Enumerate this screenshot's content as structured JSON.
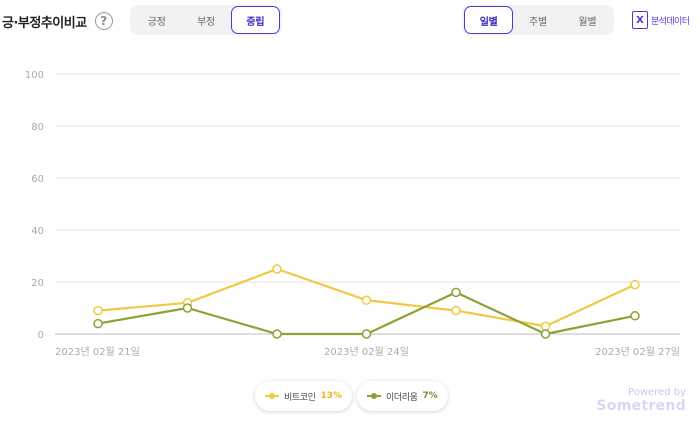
{
  "header": {
    "title": "긍·부정추이비교",
    "help_glyph": "?",
    "sentiment_tabs": [
      {
        "label": "긍정",
        "active": false
      },
      {
        "label": "부정",
        "active": false
      },
      {
        "label": "중립",
        "active": true
      }
    ],
    "period_tabs": [
      {
        "label": "일별",
        "active": true
      },
      {
        "label": "주별",
        "active": false
      },
      {
        "label": "월별",
        "active": false
      }
    ],
    "export": {
      "label": "분석데이터",
      "icon": "excel-icon",
      "icon_glyph": "X"
    }
  },
  "chart_data": {
    "type": "line",
    "x": [
      "2023-02-21",
      "2023-02-22",
      "2023-02-23",
      "2023-02-24",
      "2023-02-25",
      "2023-02-26",
      "2023-02-27"
    ],
    "x_tick_labels": [
      "2023년 02월 21일",
      "2023년 02월 24일",
      "2023년 02월 27일"
    ],
    "x_tick_index": [
      0,
      3,
      6
    ],
    "ylim": [
      0,
      100
    ],
    "y_ticks": [
      0,
      20,
      40,
      60,
      80,
      100
    ],
    "grid": true,
    "legend": "bottom-center",
    "series": [
      {
        "name": "비트코인",
        "color": "#f2c744",
        "values": [
          9,
          12,
          25,
          13,
          9,
          3,
          19
        ]
      },
      {
        "name": "이더리움",
        "color": "#8da235",
        "values": [
          4,
          10,
          0,
          0,
          16,
          0,
          7
        ]
      }
    ]
  },
  "legend": [
    {
      "name": "비트코인",
      "pct": "13%",
      "color": "#f2c744"
    },
    {
      "name": "이더리움",
      "pct": "7%",
      "color": "#8da235"
    }
  ],
  "branding": {
    "powered_by": "Powered by",
    "brand": "Sometrend"
  }
}
